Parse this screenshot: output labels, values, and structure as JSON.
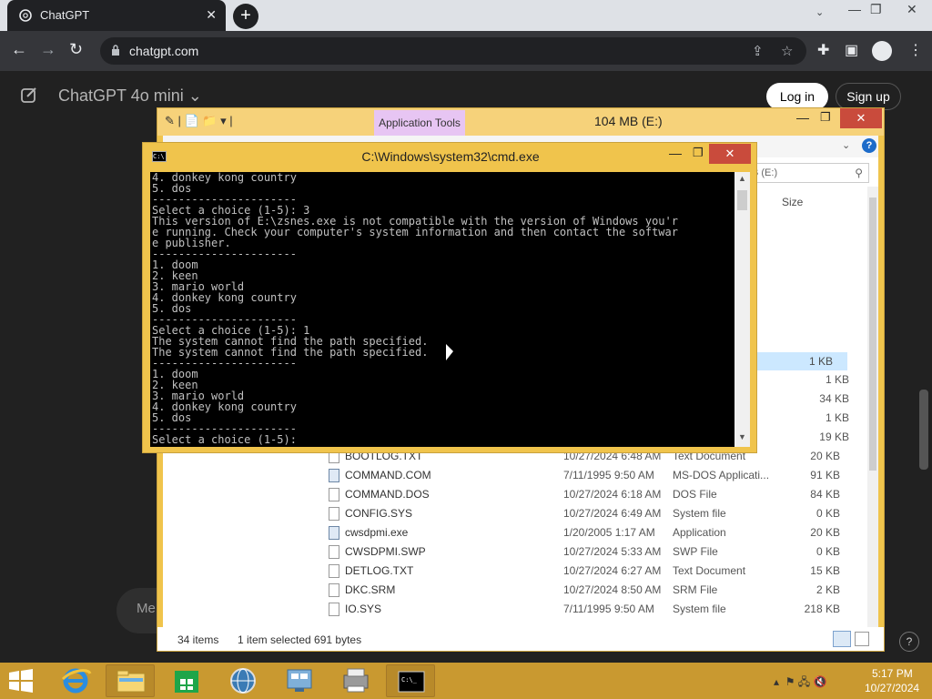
{
  "chrome": {
    "tab_title": "ChatGPT",
    "tab_close": "✕",
    "new_tab": "+",
    "url": "chatgpt.com",
    "window_controls": {
      "minimize": "—",
      "maximize": "❐",
      "close": "✕"
    }
  },
  "chatgpt": {
    "model_label": "ChatGPT 4o mini",
    "login": "Log in",
    "signup": "Sign up",
    "message_placeholder_fragment": "Me",
    "help": "?"
  },
  "explorer": {
    "application_tools": "Application Tools",
    "caption": "104 MB (E:)",
    "search_placeholder": "B (E:)",
    "col_size": "Size",
    "selected_row": {
      "type_fragment": "le",
      "size": "1 KB"
    },
    "partial_sizes": [
      "1 KB",
      "34 KB",
      "1 KB",
      "19 KB"
    ],
    "files": [
      {
        "name": "BOOTLOG.TXT",
        "date": "10/27/2024 6:48 AM",
        "type": "Text Document",
        "size": "20 KB",
        "icon": "doc"
      },
      {
        "name": "COMMAND.COM",
        "date": "7/11/1995 9:50 AM",
        "type": "MS-DOS Applicati...",
        "size": "91 KB",
        "icon": "app"
      },
      {
        "name": "COMMAND.DOS",
        "date": "10/27/2024 6:18 AM",
        "type": "DOS File",
        "size": "84 KB",
        "icon": "doc"
      },
      {
        "name": "CONFIG.SYS",
        "date": "10/27/2024 6:49 AM",
        "type": "System file",
        "size": "0 KB",
        "icon": "doc"
      },
      {
        "name": "cwsdpmi.exe",
        "date": "1/20/2005 1:17 AM",
        "type": "Application",
        "size": "20 KB",
        "icon": "app"
      },
      {
        "name": "CWSDPMI.SWP",
        "date": "10/27/2024 5:33 AM",
        "type": "SWP File",
        "size": "0 KB",
        "icon": "doc"
      },
      {
        "name": "DETLOG.TXT",
        "date": "10/27/2024 6:27 AM",
        "type": "Text Document",
        "size": "15 KB",
        "icon": "doc"
      },
      {
        "name": "DKC.SRM",
        "date": "10/27/2024 8:50 AM",
        "type": "SRM File",
        "size": "2 KB",
        "icon": "doc"
      },
      {
        "name": "IO.SYS",
        "date": "7/11/1995 9:50 AM",
        "type": "System file",
        "size": "218 KB",
        "icon": "doc"
      }
    ],
    "status_items": "34 items",
    "status_selected": "1 item selected  691 bytes"
  },
  "cmd": {
    "title": "C:\\Windows\\system32\\cmd.exe",
    "console_text": "4. donkey kong country\n5. dos\n----------------------\nSelect a choice (1-5): 3\nThis version of E:\\zsnes.exe is not compatible with the version of Windows you'r\ne running. Check your computer's system information and then contact the softwar\ne publisher.\n----------------------\n1. doom\n2. keen\n3. mario world\n4. donkey kong country\n5. dos\n----------------------\nSelect a choice (1-5): 1\nThe system cannot find the path specified.\nThe system cannot find the path specified.\n----------------------\n1. doom\n2. keen\n3. mario world\n4. donkey kong country\n5. dos\n----------------------\nSelect a choice (1-5): "
  },
  "taskbar": {
    "time": "5:17 PM",
    "date": "10/27/2024"
  }
}
